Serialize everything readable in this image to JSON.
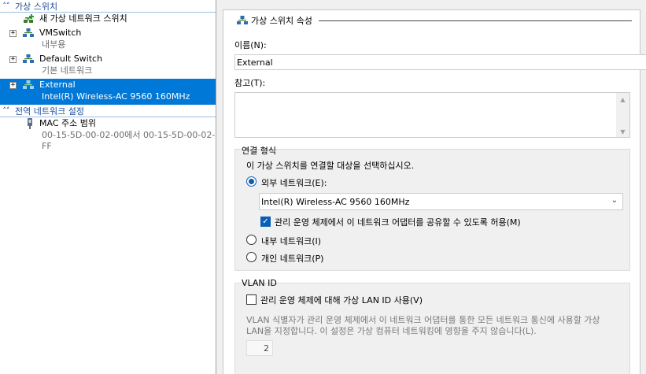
{
  "tree": {
    "virtual_switches_header": "가상 스위치",
    "new_switch_label": "새 가상 네트워크 스위치",
    "switches": [
      {
        "name": "VMSwitch",
        "detail": "내부용"
      },
      {
        "name": "Default Switch",
        "detail": "기본 네트워크"
      },
      {
        "name": "External",
        "detail": "Intel(R) Wireless-AC 9560 160MHz"
      }
    ],
    "global_header": "전역 네트워크 설정",
    "mac_range": {
      "name": "MAC 주소 범위",
      "detail": "00-15-5D-00-02-00에서 00-15-5D-00-02-FF"
    }
  },
  "properties": {
    "title": "가상 스위치 속성",
    "name_label": "이름(N):",
    "name_value": "External",
    "notes_label": "참고(T):",
    "notes_value": "",
    "connection": {
      "title": "연결 형식",
      "prompt": "이 가상 스위치를 연결할 대상을 선택하십시오.",
      "external_label": "외부 네트워크(E):",
      "adapter_selected": "Intel(R) Wireless-AC 9560 160MHz",
      "share_label": "관리 운영 체제에서 이 네트워크 어댑터를 공유할 수 있도록 허용(M)",
      "share_checked": true,
      "internal_label": "내부 네트워크(I)",
      "private_label": "개인 네트워크(P)",
      "selected": "external"
    },
    "vlan": {
      "title": "VLAN ID",
      "enable_label": "관리 운영 체제에 대해 가상 LAN ID 사용(V)",
      "enabled": false,
      "description": "VLAN 식별자가 관리 운영 체제에서 이 네트워크 어댑터를 통한 모든 네트워크 통신에 사용할 가상 LAN을 지정합니다. 이 설정은 가상 컴퓨터 네트워킹에 영향을 주지 않습니다(L).",
      "id_value": "2"
    }
  },
  "colors": {
    "selection": "#0078d7",
    "header_text": "#1f4ea0",
    "accent": "#0a5fb4"
  }
}
